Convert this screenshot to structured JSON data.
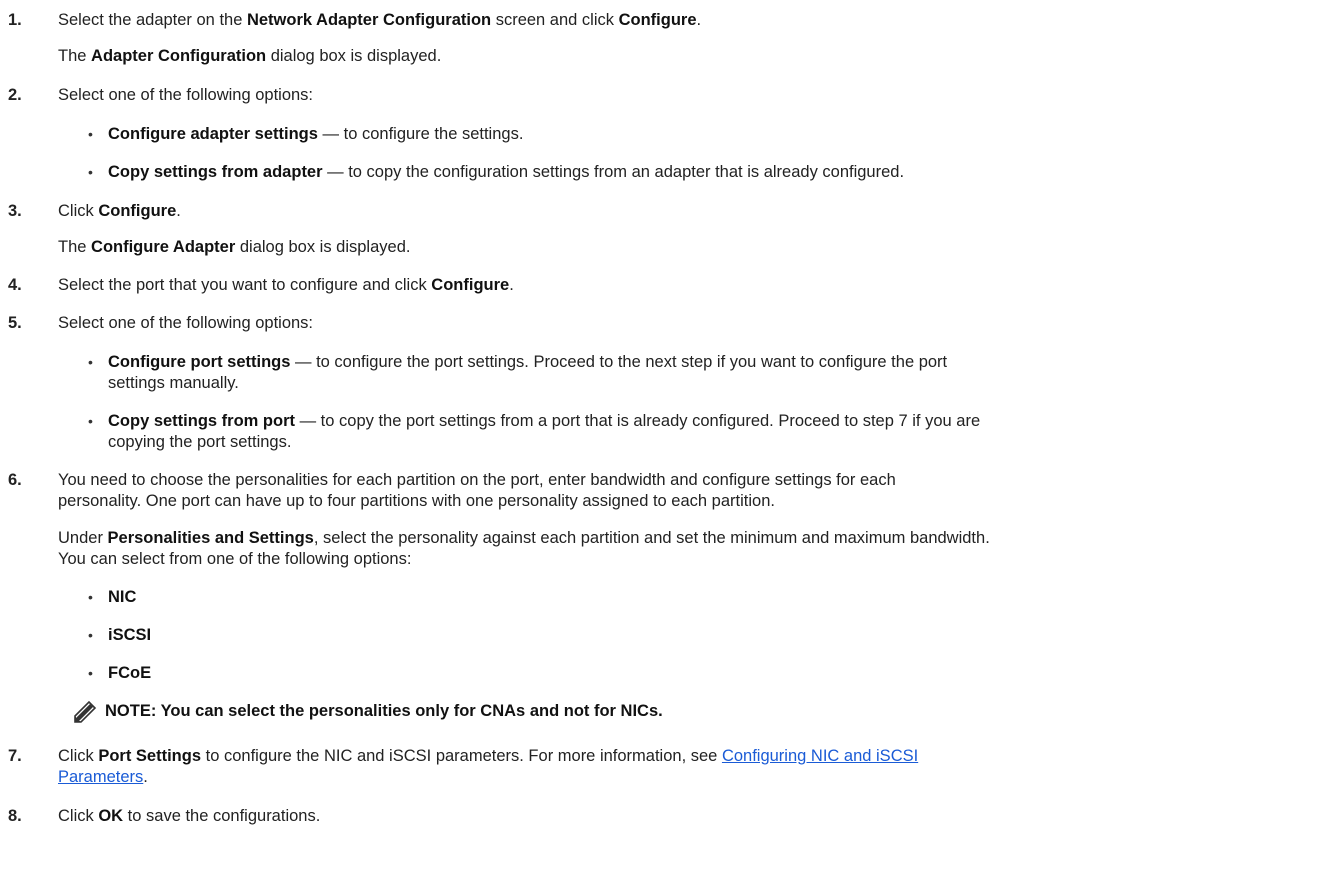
{
  "steps": [
    {
      "number": "1.",
      "text_pre": "Select the adapter on the ",
      "bold1": "Network Adapter Configuration",
      "text_mid": " screen and click ",
      "bold2": "Configure",
      "text_post": ".",
      "sub_pre": "The ",
      "sub_bold": "Adapter Configuration",
      "sub_post": " dialog box is displayed."
    },
    {
      "number": "2.",
      "text": "Select one of the following options:",
      "bullets": [
        {
          "bold": "Configure adapter settings",
          "text": " — to configure the settings."
        },
        {
          "bold": "Copy settings from adapter",
          "text": " — to copy the configuration settings from an adapter that is already configured."
        }
      ]
    },
    {
      "number": "3.",
      "text_pre": "Click ",
      "bold": "Configure",
      "text_post": ".",
      "sub_pre": "The ",
      "sub_bold": "Configure Adapter",
      "sub_post": " dialog box is displayed."
    },
    {
      "number": "4.",
      "text_pre": "Select the port that you want to configure and click ",
      "bold": "Configure",
      "text_post": "."
    },
    {
      "number": "5.",
      "text": "Select one of the following options:",
      "bullets": [
        {
          "bold": "Configure port settings",
          "text_l1": " — to configure the port settings. Proceed to the next step if you want to configure the port",
          "text_l2": "settings manually."
        },
        {
          "bold": "Copy settings from port",
          "text_l1": " — to copy the port settings from a port that is already configured. Proceed to step 7 if you are",
          "text_l2": "copying the port settings."
        }
      ]
    },
    {
      "number": "6.",
      "text_l1": "You need to choose the personalities for each partition on the port, enter bandwidth and configure settings for each",
      "text_l2": "personality. One port can have up to four partitions with one personality assigned to each partition.",
      "para_pre": "Under ",
      "para_bold": "Personalities and Settings",
      "para_post": ", select the personality against each partition and set the minimum and maximum bandwidth.",
      "para_l2": "You can select from one of the following options:",
      "options": [
        "NIC",
        "iSCSI",
        "FCoE"
      ],
      "note": "NOTE: You can select the personalities only for CNAs and not for NICs."
    },
    {
      "number": "7.",
      "text_pre": "Click ",
      "bold": "Port Settings",
      "text_mid": " to configure the NIC and iSCSI parameters. For more information, see ",
      "link_l1": "Configuring NIC and iSCSI",
      "link_l2": "Parameters",
      "text_post": "."
    },
    {
      "number": "8.",
      "text_pre": "Click ",
      "bold": "OK",
      "text_post": " to save the configurations."
    }
  ],
  "icons": {
    "note": "pencil-note-icon"
  },
  "colors": {
    "link": "#1a5bd6",
    "text": "#222222"
  }
}
